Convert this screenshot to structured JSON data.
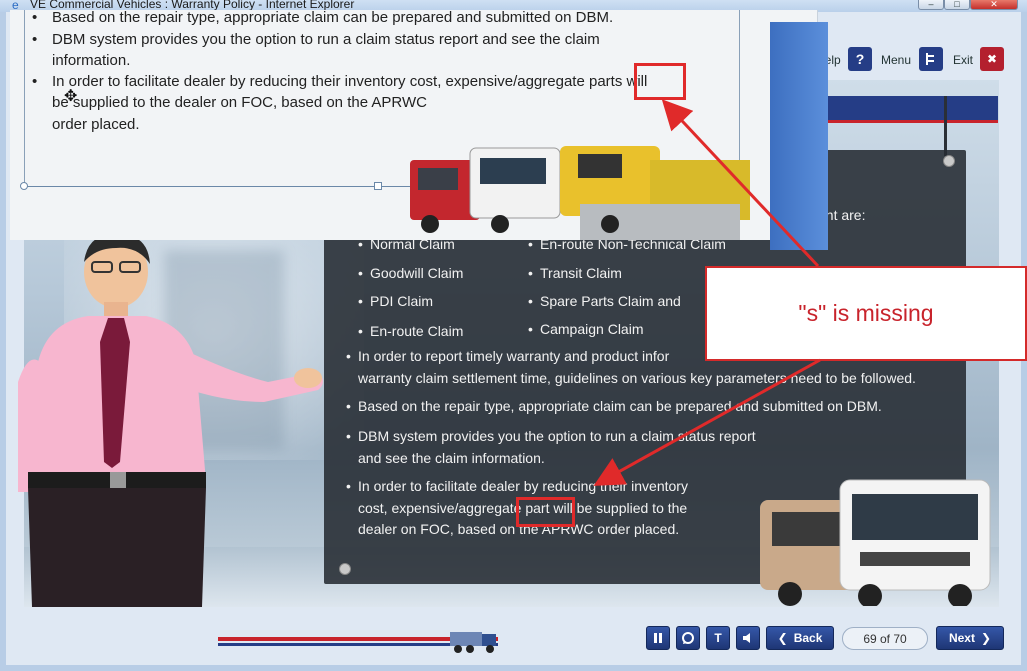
{
  "window": {
    "title": "VE Commercial Vehicles : Warranty Policy - Internet Explorer",
    "min": "–",
    "max": "□",
    "close": "✕"
  },
  "header_tools": {
    "help_label": "Help",
    "menu_label": "Menu",
    "exit_label": "Exit",
    "help_icon": "?",
    "exit_icon": "✖"
  },
  "panel": {
    "intro_tail": "ent are:",
    "claim_types": [
      "Normal Claim",
      "En-route Non-Technical Claim",
      "Goodwill Claim",
      "Transit Claim",
      "PDI Claim",
      "Spare Parts Claim and",
      "En-route Claim",
      "Campaign Claim"
    ],
    "bullet1_line1": "In order to report timely warranty and product infor",
    "bullet1_line2": "warranty claim settlement time, guidelines on various key parameters need to be followed.",
    "bullet2": "Based on the repair type, appropriate claim can be prepared and submitted on DBM.",
    "bullet3_line1": "DBM system provides you the option to run a claim status report",
    "bullet3_line2": "and see the claim information.",
    "bullet4_line1": "In order to facilitate dealer by reducing their inventory",
    "bullet4_line2": "cost, expensive/aggregate part will be supplied to the",
    "bullet4_line3": "dealer on FOC, based on the APRWC order placed."
  },
  "overlay": {
    "line1": "Based on the repair type, appropriate claim can be prepared and submitted on DBM.",
    "line2a": "DBM system provides you the option to run a claim status report and see the claim",
    "line2b": "information.",
    "line3a": "In order to facilitate dealer by reducing their inventory cost, expensive/aggregate parts will",
    "line3b": "be supplied to the dealer on FOC, based on the APRWC",
    "line3c": "order placed."
  },
  "callout": {
    "text": "\"s\" is missing"
  },
  "navigation": {
    "back_label": "Back",
    "next_label": "Next",
    "page_counter": "69 of 70",
    "pause_icon": "pause-icon",
    "replay_icon": "replay-icon",
    "text_icon": "T",
    "audio_icon": "speaker-icon"
  },
  "colors": {
    "navy": "#253d86",
    "red": "#c8232b",
    "panel": "#2a2f36",
    "callout_red": "#d42a2a"
  }
}
